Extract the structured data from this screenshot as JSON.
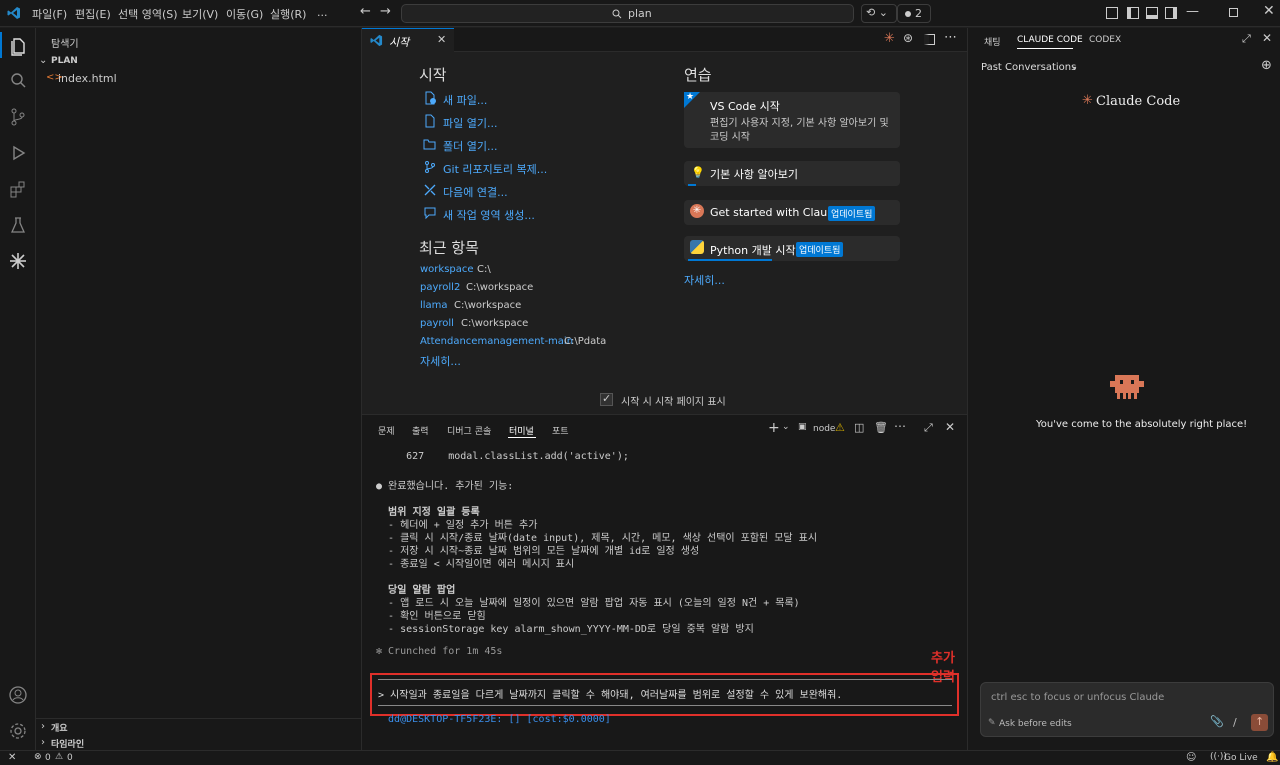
{
  "titlebar": {
    "menus": [
      "파일(F)",
      "편집(E)",
      "선택 영역(S)",
      "보기(V)",
      "이동(G)",
      "실행(R)",
      "..."
    ],
    "search_text": "plan",
    "badge_count": "2"
  },
  "sidebar": {
    "title": "탐색기",
    "folder": "PLAN",
    "file": "index.html",
    "outline": "개요",
    "timeline": "타임라인"
  },
  "tab": {
    "label": "시작"
  },
  "welcome": {
    "start_heading": "시작",
    "start_links": [
      "새 파일...",
      "파일 열기...",
      "폴더 열기...",
      "Git 리포지토리 복제...",
      "다음에 연결...",
      "새 작업 영역 생성..."
    ],
    "recent_heading": "최근 항목",
    "recent": [
      {
        "name": "workspace",
        "path": "C:\\"
      },
      {
        "name": "payroll2",
        "path": "C:\\workspace"
      },
      {
        "name": "llama",
        "path": "C:\\workspace"
      },
      {
        "name": "payroll",
        "path": "C:\\workspace"
      },
      {
        "name": "Attendancemanagement-main",
        "path": "C:\\Pdata"
      }
    ],
    "recent_more": "자세히...",
    "practice_heading": "연습",
    "card1_title": "VS Code 시작",
    "card1_desc1": "편집기 사용자 지정, 기본 사항 알아보기 및",
    "card1_desc2": "코딩 시작",
    "card2_title": "기본 사항 알아보기",
    "card3_title": "Get started with Clau...",
    "card4_title": "Python 개발 시작",
    "updated_badge": "업데이트됨",
    "practice_more": "자세히...",
    "show_on_startup": "시작 시 시작 페이지 표시"
  },
  "panel": {
    "tabs": [
      "문제",
      "출력",
      "디버그 콘솔",
      "터미널",
      "포트"
    ],
    "active_tab": "터미널",
    "terminal_name": "node",
    "lines": [
      "     627    modal.classList.add('active');",
      "",
      "● 완료했습니다. 추가된 기능:",
      "",
      "  범위 지정 일괄 등록",
      "  - 헤더에 + 일정 추가 버튼 추가",
      "  - 클릭 시 시작/종료 날짜(date input), 제목, 시간, 메모, 색상 선택이 포함된 모달 표시",
      "  - 저장 시 시작~종료 날짜 범위의 모든 날짜에 개별 id로 일정 생성",
      "  - 종료일 < 시작일이면 에러 메시지 표시",
      "",
      "  당일 알람 팝업",
      "  - 앱 로드 시 오늘 날짜에 일정이 있으면 알람 팝업 자동 표시 (오늘의 일정 N건 + 목록)",
      "  - 확인 버튼으로 닫힘",
      "  - sessionStorage key alarm_shown_YYYY-MM-DD로 당일 중복 알람 방지",
      "",
      "✻ Crunched for 1m 45s"
    ],
    "prompt": "> 시작일과 종료일을 다르게 날짜까지 클릭할 수 해야돼, 여러날짜를 범위로 설정할 수 있게 보완해줘.",
    "footer": "  dd@DESKTOP-TF5F23E: [] [cost:$0.0000]",
    "annotation": "추가 입력",
    "annotation_color": "#e0302a"
  },
  "right": {
    "tabs": [
      "채팅",
      "CLAUDE CODE",
      "CODEX"
    ],
    "past_conversations": "Past Conversations",
    "brand": "Claude Code",
    "welcome_msg": "You've come to the absolutely right place!",
    "input_placeholder": "ctrl esc to focus or unfocus Claude",
    "mode": "Ask before edits",
    "accent": "#d97757"
  },
  "status": {
    "errors": "0",
    "warnings": "0",
    "golive": "Go Live"
  }
}
